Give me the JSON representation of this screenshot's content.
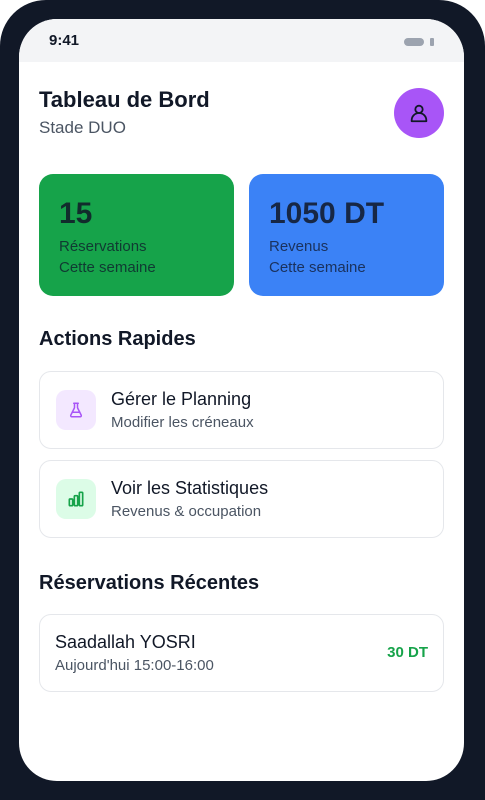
{
  "status_bar": {
    "time": "9:41"
  },
  "header": {
    "title": "Tableau de Bord",
    "subtitle": "Stade DUO",
    "avatar_icon": "user-icon",
    "avatar_color": "#a855f7"
  },
  "stats": [
    {
      "value": "15",
      "label": "Réservations",
      "period": "Cette semaine",
      "color": "#16a34a"
    },
    {
      "value": "1050 DT",
      "label": "Revenus",
      "period": "Cette semaine",
      "color": "#3b82f6"
    }
  ],
  "quick_actions": {
    "title": "Actions Rapides",
    "items": [
      {
        "title": "Gérer le Planning",
        "subtitle": "Modifier les créneaux",
        "icon": "flask-icon",
        "icon_bg": "#f3e8ff",
        "icon_color": "#a855f7"
      },
      {
        "title": "Voir les Statistiques",
        "subtitle": "Revenus & occupation",
        "icon": "bar-chart-icon",
        "icon_bg": "#dcfce7",
        "icon_color": "#16a34a"
      }
    ]
  },
  "recent_reservations": {
    "title": "Réservations Récentes",
    "items": [
      {
        "name": "Saadallah YOSRI",
        "time": "Aujourd'hui 15:00-16:00",
        "amount": "30 DT"
      }
    ]
  }
}
